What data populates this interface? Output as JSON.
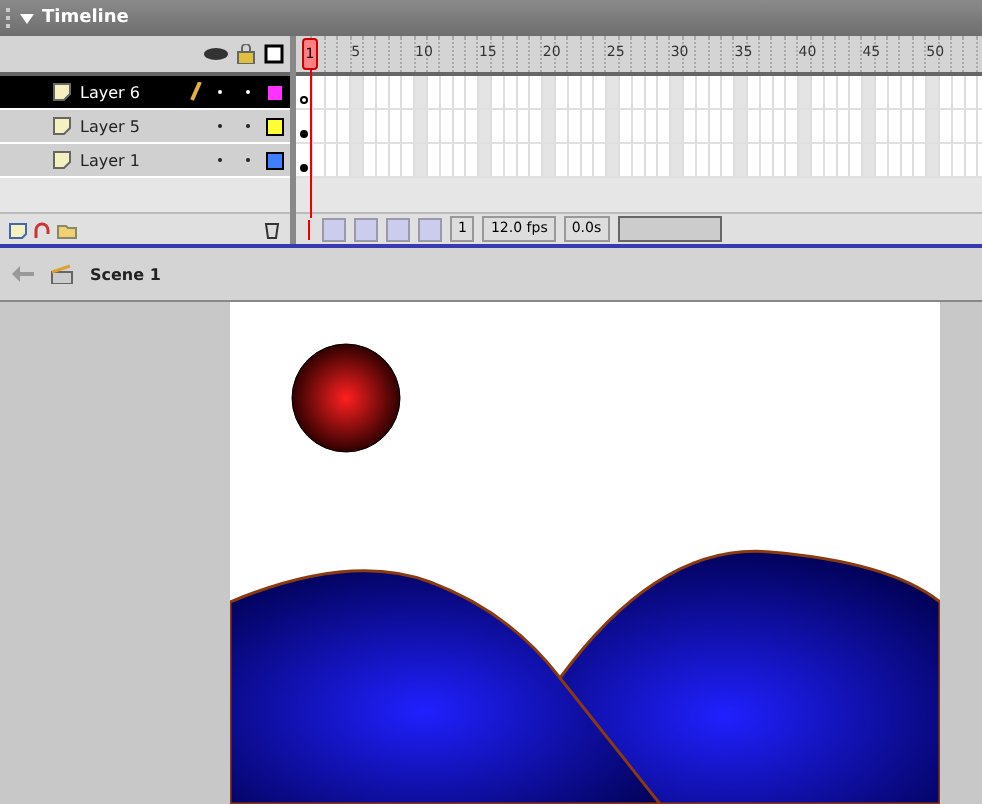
{
  "panel": {
    "title": "Timeline"
  },
  "layers": [
    {
      "name": "Layer 6",
      "selected": true,
      "editing": true,
      "color": "#ff33ff",
      "filled_keyframe": false
    },
    {
      "name": "Layer 5",
      "selected": false,
      "editing": false,
      "color": "#ffff33",
      "filled_keyframe": true
    },
    {
      "name": "Layer 1",
      "selected": false,
      "editing": false,
      "color": "#3f7fff",
      "filled_keyframe": true
    }
  ],
  "ruler_labels": [
    "1",
    "5",
    "10",
    "15",
    "20",
    "25",
    "30",
    "35",
    "40",
    "45",
    "50"
  ],
  "status": {
    "current_frame": "1",
    "frame_rate": "12.0 fps",
    "elapsed": "0.0s"
  },
  "scene": {
    "name": "Scene 1"
  }
}
